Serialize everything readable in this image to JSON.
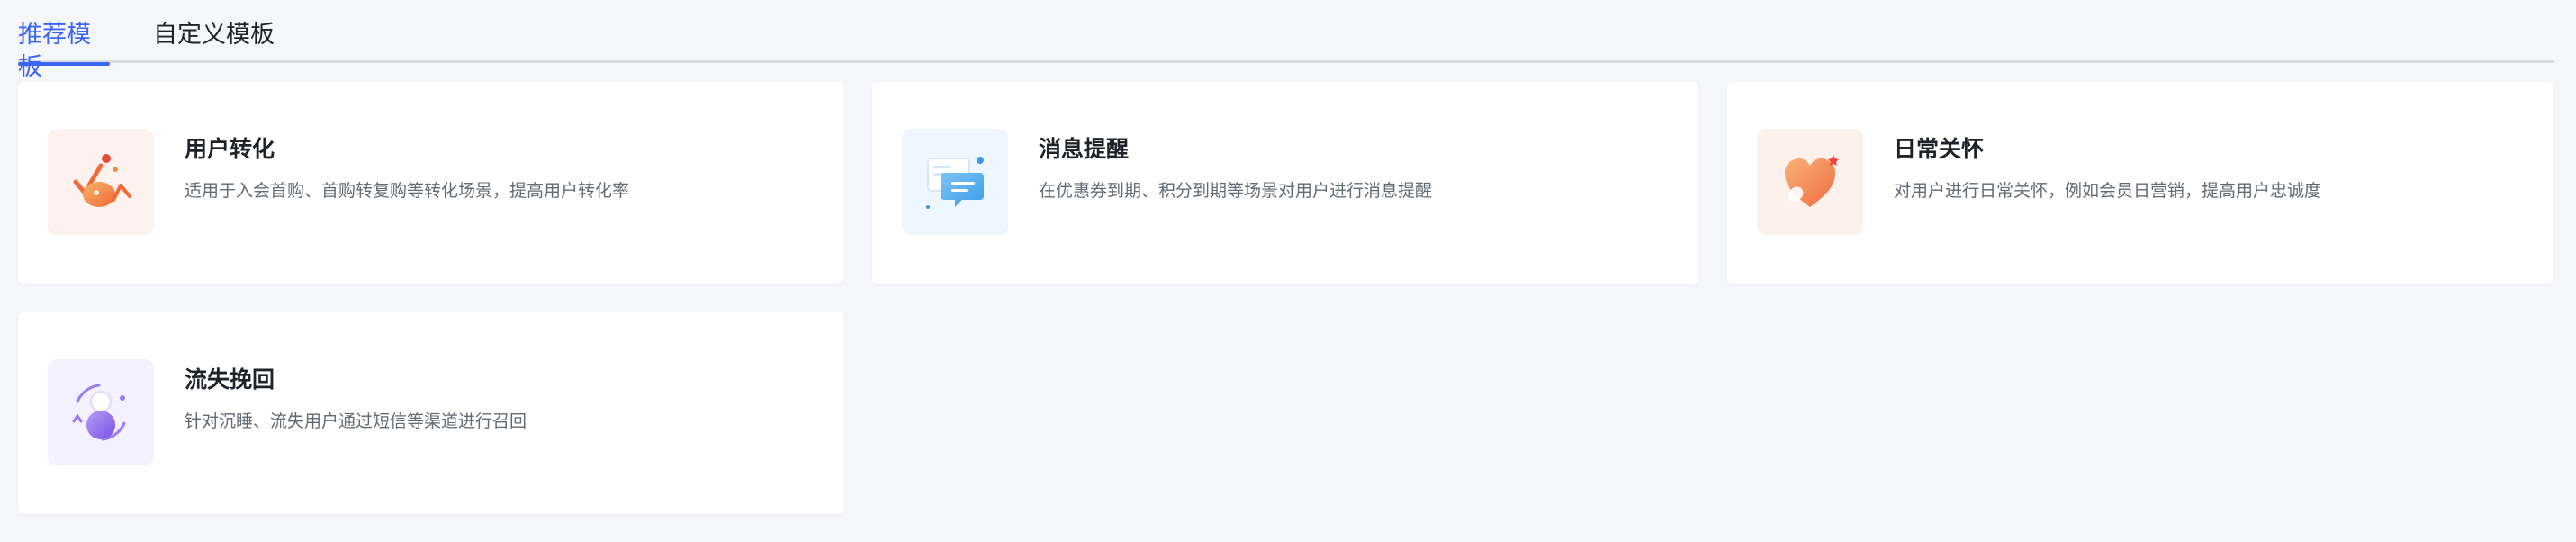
{
  "tabs": [
    {
      "label": "推荐模板",
      "active": true
    },
    {
      "label": "自定义模板",
      "active": false
    }
  ],
  "colors": {
    "accent": "#3b66f5",
    "title": "#1f2329",
    "description": "#646a73",
    "background": "#f5f6fa"
  },
  "cards": [
    {
      "title": "用户转化",
      "description": "适用于入会首购、首购转复购等转化场景，提高用户转化率",
      "icon": "user-conversion-icon"
    },
    {
      "title": "消息提醒",
      "description": "在优惠券到期、积分到期等场景对用户进行消息提醒",
      "icon": "message-reminder-icon"
    },
    {
      "title": "日常关怀",
      "description": "对用户进行日常关怀，例如会员日营销，提高用户忠诚度",
      "icon": "daily-care-icon"
    },
    {
      "title": "流失挽回",
      "description": "针对沉睡、流失用户通过短信等渠道进行召回",
      "icon": "churn-recovery-icon"
    }
  ]
}
